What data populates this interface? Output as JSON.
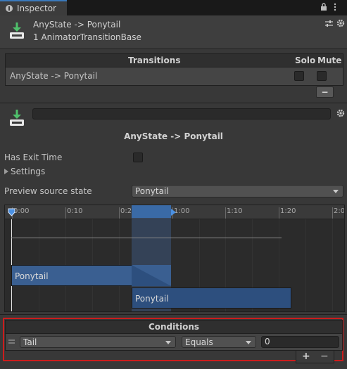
{
  "tab": {
    "title": "Inspector"
  },
  "header": {
    "title": "AnyState -> Ponytail",
    "subtitle": "1 AnimatorTransitionBase"
  },
  "transitions": {
    "header": "Transitions",
    "solo_label": "Solo",
    "mute_label": "Mute",
    "rows": [
      {
        "name": "AnyState -> Ponytail"
      }
    ],
    "remove_label": "−"
  },
  "transition": {
    "name_value": "",
    "title": "AnyState -> Ponytail",
    "has_exit_time_label": "Has Exit Time",
    "settings_label": "Settings",
    "preview_source_label": "Preview source state",
    "preview_source_value": "Ponytail"
  },
  "timeline": {
    "ticks": [
      "0:00",
      "0:10",
      "0:20",
      "1:00",
      "1:10",
      "1:20",
      "2:0"
    ],
    "source_clip": "Ponytail",
    "dest_clip": "Ponytail"
  },
  "conditions": {
    "header": "Conditions",
    "parameter": "Tail",
    "operator": "Equals",
    "value": "0",
    "add_label": "+",
    "remove_label": "−"
  },
  "colors": {
    "accent": "#3a79bb",
    "clip": "#3a5f91",
    "highlight_border": "#cc1c1c"
  }
}
